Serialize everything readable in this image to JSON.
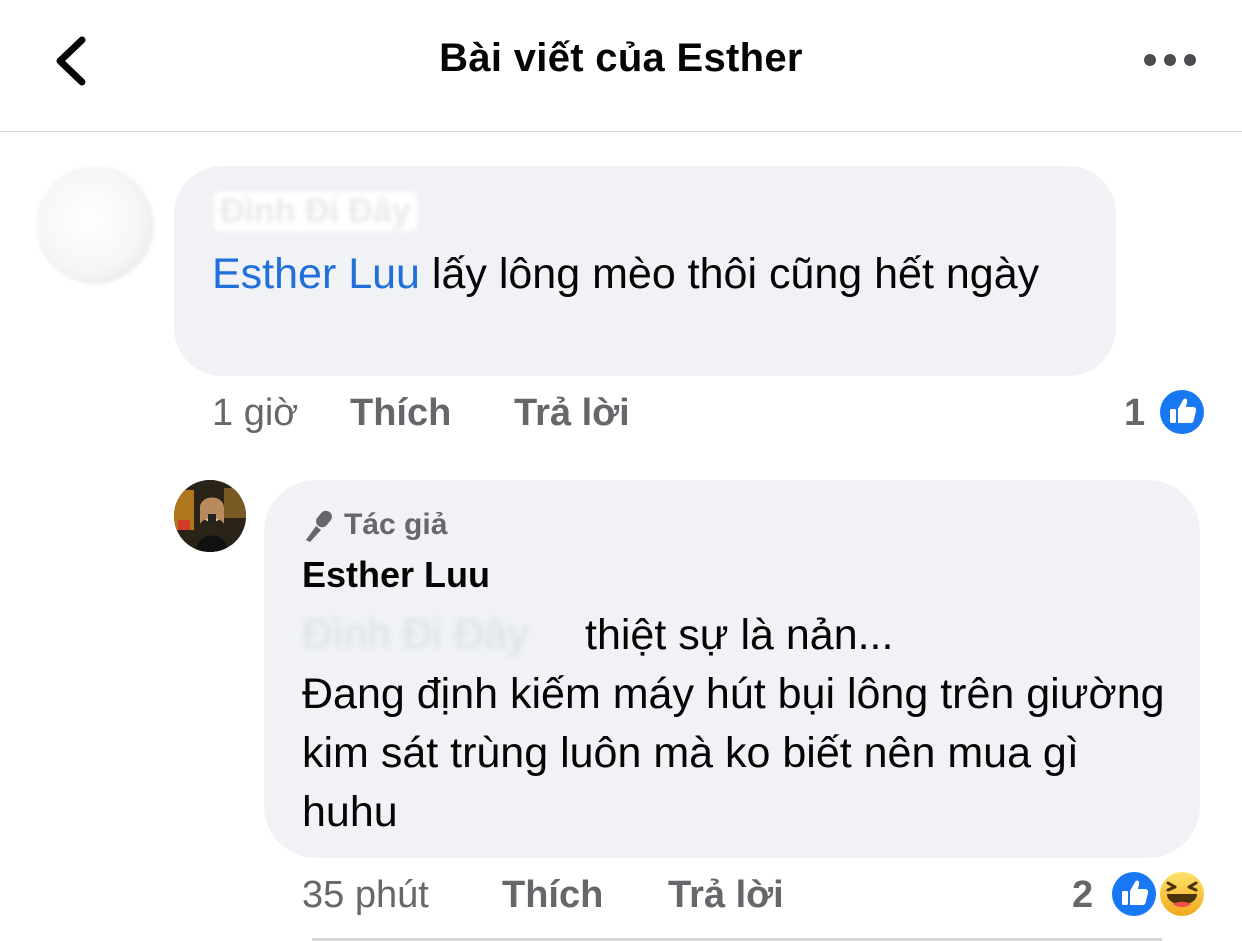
{
  "header": {
    "title": "Bài viết của Esther"
  },
  "comment": {
    "author_blurred": "Đình Đi Đây",
    "mention": "Esther Luu",
    "text": "lấy lông mèo thôi cũng hết ngày",
    "time": "1 giờ",
    "like_label": "Thích",
    "reply_label": "Trả lời",
    "reaction_count": "1"
  },
  "reply": {
    "badge": "Tác giả",
    "author": "Esther Luu",
    "mention_blurred": "Đình Đi Đây",
    "line1": "thiệt sự là nản...",
    "line2": "Đang định kiếm máy hút bụi lông trên giường kim sát trùng luôn mà ko biết nên mua gì huhu",
    "time": "35 phút",
    "like_label": "Thích",
    "reply_label": "Trả lời",
    "reaction_count": "2"
  },
  "colors": {
    "mention": "#216fdb",
    "bubble": "#f0f2f5",
    "meta": "#65676b",
    "like_blue": "#1877f2",
    "haha_yellow": "#f7b125"
  },
  "icons": [
    "back-chevron-icon",
    "more-dots-icon",
    "like-reaction-icon",
    "haha-reaction-icon",
    "author-mic-icon"
  ]
}
